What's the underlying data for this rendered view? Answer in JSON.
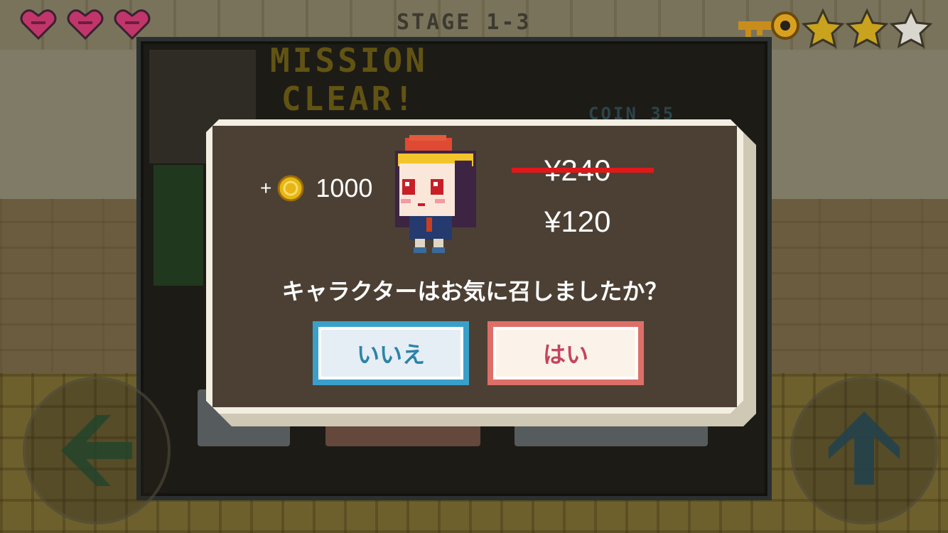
{
  "hud": {
    "hearts": [
      "heart-icon",
      "heart-icon",
      "heart-icon"
    ],
    "stage_label": "STAGE 1-3",
    "stars_earned": 2,
    "stars_total": 3
  },
  "result_panel": {
    "title_line1": "MISSION",
    "title_line2": "CLEAR!",
    "coin_label": "COIN 35"
  },
  "dialog": {
    "reward_plus": "+",
    "reward_amount": "1000",
    "old_price": "¥240",
    "new_price": "¥120",
    "question": "キャラクターはお気に召しましたか？",
    "no_label": "いいえ",
    "yes_label": "はい"
  },
  "colors": {
    "dialog_bg": "#4c4034",
    "dialog_border": "#f2eee2",
    "no_button": "#3aa0c9",
    "yes_button": "#de6f68",
    "strike": "#e0181a"
  }
}
